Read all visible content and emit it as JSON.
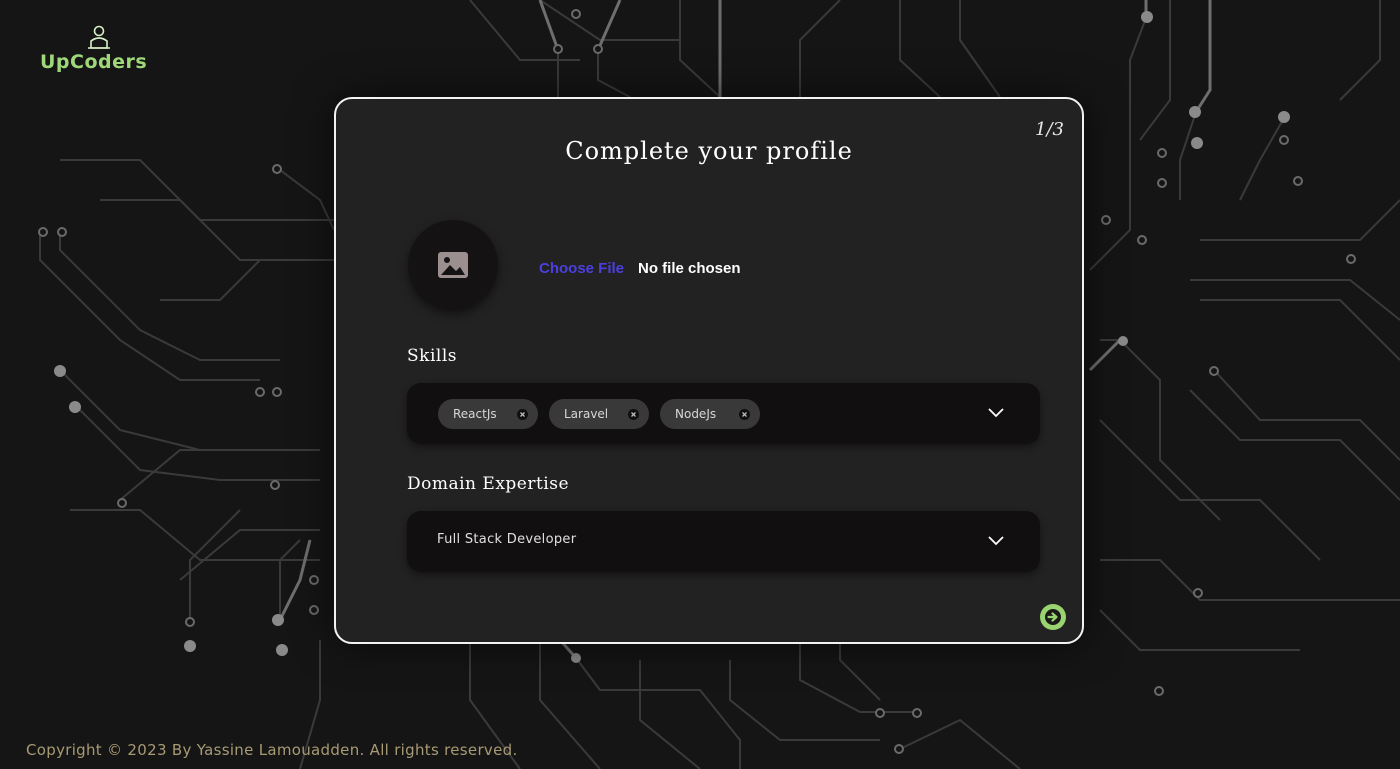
{
  "brand": {
    "name": "UpCoders",
    "logo_icon": "coder-person-icon",
    "color": "#9fd878"
  },
  "card": {
    "step": "1/3",
    "title": "Complete your profile",
    "avatar_icon": "image-icon",
    "file_input": {
      "button_label": "Choose File",
      "status": "No file chosen"
    },
    "skills": {
      "label": "Skills",
      "selected": [
        "ReactJs",
        "Laravel",
        "NodeJs"
      ]
    },
    "domain": {
      "label": "Domain Expertise",
      "value": "Full Stack Developer"
    },
    "next_icon": "arrow-right-circle-icon"
  },
  "footer": {
    "copyright": "Copyright © 2023 By Yassine Lamouadden. All rights reserved."
  },
  "colors": {
    "accent_green": "#9ad46f",
    "link_blue": "#4c3fe0",
    "card_bg": "#222223"
  }
}
